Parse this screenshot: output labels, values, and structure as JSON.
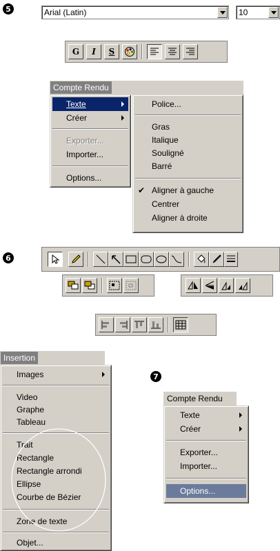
{
  "steps": {
    "s5": "5",
    "s6": "6",
    "s7": "7"
  },
  "font_combo": {
    "font": "Arial (Latin)",
    "size": "10"
  },
  "format_toolbar": {
    "bold": "G",
    "italic": "I",
    "underline": "S"
  },
  "menu1": {
    "title": "Compte Rendu",
    "items": [
      {
        "label": "Texte",
        "submenu": true,
        "highlighted": true
      },
      {
        "label": "Créer",
        "submenu": true
      },
      {
        "label": "Exporter...",
        "disabled": true
      },
      {
        "label": "Importer..."
      },
      {
        "label": "Options..."
      }
    ],
    "submenu": [
      {
        "label": "Police..."
      },
      {
        "label": "Gras"
      },
      {
        "label": "Italique"
      },
      {
        "label": "Souligné"
      },
      {
        "label": "Barré"
      },
      {
        "label": "Aligner à gauche",
        "checked": true
      },
      {
        "label": "Centrer"
      },
      {
        "label": "Aligner à droite"
      }
    ]
  },
  "menu2": {
    "title": "Insertion",
    "items": [
      {
        "label": "Images",
        "submenu": true
      },
      {
        "label": "Video"
      },
      {
        "label": "Graphe"
      },
      {
        "label": "Tableau"
      },
      {
        "label": "Trait"
      },
      {
        "label": "Rectangle"
      },
      {
        "label": "Rectangle arrondi"
      },
      {
        "label": "Ellipse"
      },
      {
        "label": "Courbe de Bézier"
      },
      {
        "label": "Zone de texte"
      },
      {
        "label": "Objet..."
      }
    ]
  },
  "menu3": {
    "title": "Compte Rendu",
    "items": [
      {
        "label": "Texte",
        "submenu": true
      },
      {
        "label": "Créer",
        "submenu": true
      },
      {
        "label": "Exporter..."
      },
      {
        "label": "Importer..."
      },
      {
        "label": "Options...",
        "highlighted": true
      }
    ]
  },
  "colors": {
    "face": "#d4d0c8",
    "highlight": "#0a246a",
    "title_active": "#808080"
  }
}
